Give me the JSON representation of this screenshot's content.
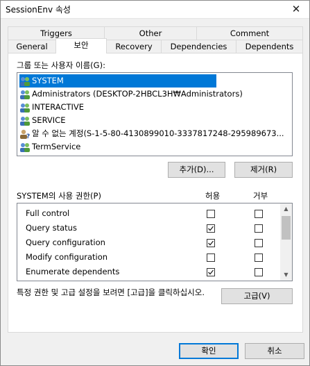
{
  "window": {
    "title": "SessionEnv 속성",
    "close_glyph": "✕"
  },
  "tabs_back": [
    "Triggers",
    "Other",
    "Comment"
  ],
  "tabs_front": [
    "General",
    "보안",
    "Recovery",
    "Dependencies",
    "Dependents"
  ],
  "active_tab": "보안",
  "groups": {
    "label": "그룹 또는 사용자 이름(G):",
    "items": [
      {
        "name": "SYSTEM",
        "icon": "users-icon",
        "selected": true
      },
      {
        "name": "Administrators (DESKTOP-2HBCL3H₩Administrators)",
        "icon": "users-icon"
      },
      {
        "name": "INTERACTIVE",
        "icon": "users-icon"
      },
      {
        "name": "SERVICE",
        "icon": "users-icon"
      },
      {
        "name": "알 수 없는 계정(S-1-5-80-4130899010-3337817248-295989673...",
        "icon": "unknown-user-icon"
      },
      {
        "name": "TermService",
        "icon": "users-icon"
      }
    ]
  },
  "buttons": {
    "add": "추가(D)...",
    "remove": "제거(R)",
    "advanced": "고급(V)",
    "ok": "확인",
    "cancel": "취소"
  },
  "permissions": {
    "label": "SYSTEM의 사용 권한(P)",
    "allow_header": "허용",
    "deny_header": "거부",
    "rows": [
      {
        "name": "Full control",
        "allow": false,
        "deny": false
      },
      {
        "name": "Query status",
        "allow": true,
        "deny": false
      },
      {
        "name": "Query configuration",
        "allow": true,
        "deny": false
      },
      {
        "name": "Modify configuration",
        "allow": false,
        "deny": false
      },
      {
        "name": "Enumerate dependents",
        "allow": true,
        "deny": false
      }
    ]
  },
  "advanced_text": "특정 권한 및 고급 설정을 보려면 [고급]을 클릭하십시오."
}
